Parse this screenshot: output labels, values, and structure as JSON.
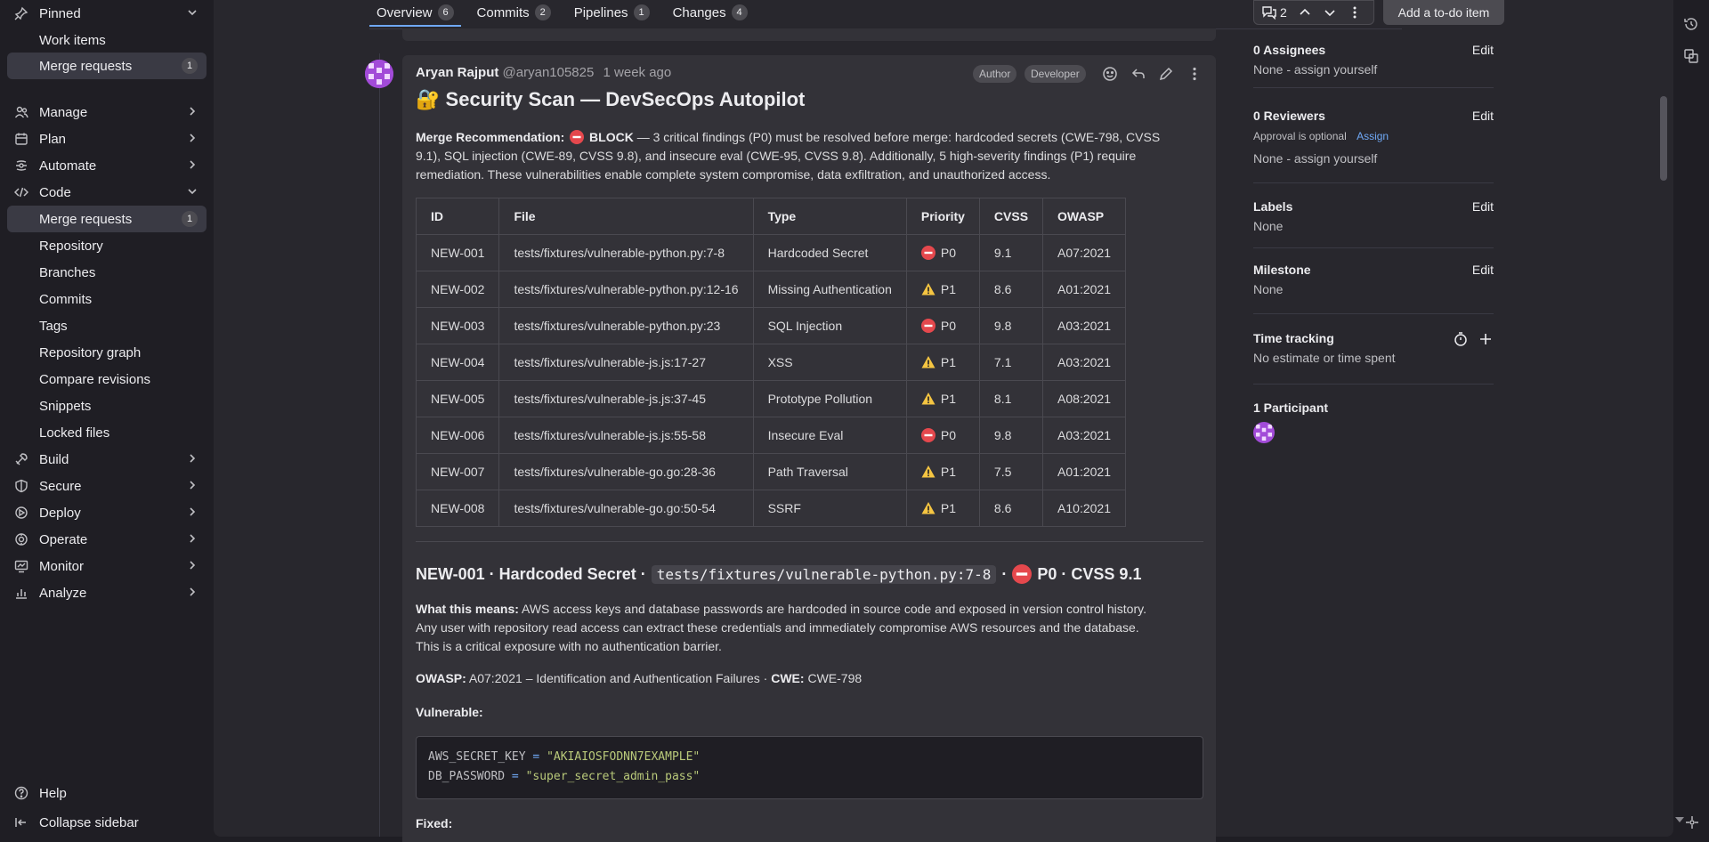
{
  "sidebar": {
    "items": [
      {
        "label": "Pinned",
        "icon": "pin-icon",
        "chevron": "down"
      },
      {
        "label": "Work items",
        "sub": true
      },
      {
        "label": "Merge requests",
        "sub": true,
        "count": "1",
        "active": true
      },
      {
        "label": "Manage",
        "icon": "users-icon",
        "chevron": "right"
      },
      {
        "label": "Plan",
        "icon": "calendar-icon",
        "chevron": "right"
      },
      {
        "label": "Automate",
        "icon": "rocket-icon",
        "chevron": "right"
      },
      {
        "label": "Code",
        "icon": "code-icon",
        "chevron": "down"
      },
      {
        "label": "Merge requests",
        "sub": true,
        "count": "1",
        "active": true
      },
      {
        "label": "Repository",
        "sub": true
      },
      {
        "label": "Branches",
        "sub": true
      },
      {
        "label": "Commits",
        "sub": true
      },
      {
        "label": "Tags",
        "sub": true
      },
      {
        "label": "Repository graph",
        "sub": true
      },
      {
        "label": "Compare revisions",
        "sub": true
      },
      {
        "label": "Snippets",
        "sub": true
      },
      {
        "label": "Locked files",
        "sub": true
      },
      {
        "label": "Build",
        "icon": "build-icon",
        "chevron": "right"
      },
      {
        "label": "Secure",
        "icon": "shield-icon",
        "chevron": "right"
      },
      {
        "label": "Deploy",
        "icon": "deploy-icon",
        "chevron": "right"
      },
      {
        "label": "Operate",
        "icon": "operate-icon",
        "chevron": "right"
      },
      {
        "label": "Monitor",
        "icon": "monitor-icon",
        "chevron": "right"
      },
      {
        "label": "Analyze",
        "icon": "chart-icon",
        "chevron": "right"
      }
    ],
    "help": "Help",
    "collapse": "Collapse sidebar"
  },
  "tabs": [
    {
      "label": "Overview",
      "count": "6",
      "active": true
    },
    {
      "label": "Commits",
      "count": "2"
    },
    {
      "label": "Pipelines",
      "count": "1"
    },
    {
      "label": "Changes",
      "count": "4"
    }
  ],
  "thread_controls": {
    "count": "2"
  },
  "todo_button": "Add a to-do item",
  "note": {
    "author_name": "Aryan Rajput",
    "author_handle": "@aryan105825",
    "time": "1 week ago",
    "badges": [
      "Author",
      "Developer"
    ],
    "title_emoji": "🔐",
    "title": "Security Scan — DevSecOps Autopilot",
    "rec_label": "Merge Recommendation:",
    "rec_status": "BLOCK",
    "rec_text_1": " — 3 critical findings (P0) must be resolved before merge: hardcoded secrets (CWE-798, CVSS",
    "rec_text_2": "9.1), SQL injection (CWE-89, CVSS 9.8), and insecure eval (CWE-95, CVSS 9.8). Additionally, 5 high-severity findings (P1) require",
    "rec_text_3": "remediation. These vulnerabilities enable complete system compromise, data exfiltration, and unauthorized access."
  },
  "table": {
    "headers": [
      "ID",
      "File",
      "Type",
      "Priority",
      "CVSS",
      "OWASP"
    ],
    "rows": [
      {
        "id": "NEW-001",
        "file": "tests/fixtures/vulnerable-python.py:7-8",
        "type": "Hardcoded Secret",
        "sev": "block",
        "priority": "P0",
        "cvss": "9.1",
        "owasp": "A07:2021"
      },
      {
        "id": "NEW-002",
        "file": "tests/fixtures/vulnerable-python.py:12-16",
        "type": "Missing Authentication",
        "sev": "warn",
        "priority": "P1",
        "cvss": "8.6",
        "owasp": "A01:2021"
      },
      {
        "id": "NEW-003",
        "file": "tests/fixtures/vulnerable-python.py:23",
        "type": "SQL Injection",
        "sev": "block",
        "priority": "P0",
        "cvss": "9.8",
        "owasp": "A03:2021"
      },
      {
        "id": "NEW-004",
        "file": "tests/fixtures/vulnerable-js.js:17-27",
        "type": "XSS",
        "sev": "warn",
        "priority": "P1",
        "cvss": "7.1",
        "owasp": "A03:2021"
      },
      {
        "id": "NEW-005",
        "file": "tests/fixtures/vulnerable-js.js:37-45",
        "type": "Prototype Pollution",
        "sev": "warn",
        "priority": "P1",
        "cvss": "8.1",
        "owasp": "A08:2021"
      },
      {
        "id": "NEW-006",
        "file": "tests/fixtures/vulnerable-js.js:55-58",
        "type": "Insecure Eval",
        "sev": "block",
        "priority": "P0",
        "cvss": "9.8",
        "owasp": "A03:2021"
      },
      {
        "id": "NEW-007",
        "file": "tests/fixtures/vulnerable-go.go:28-36",
        "type": "Path Traversal",
        "sev": "warn",
        "priority": "P1",
        "cvss": "7.5",
        "owasp": "A01:2021"
      },
      {
        "id": "NEW-008",
        "file": "tests/fixtures/vulnerable-go.go:50-54",
        "type": "SSRF",
        "sev": "warn",
        "priority": "P1",
        "cvss": "8.6",
        "owasp": "A10:2021"
      }
    ]
  },
  "finding": {
    "heading_pre": "NEW-001 · Hardcoded Secret ·",
    "heading_code": "tests/fixtures/vulnerable-python.py:7-8",
    "heading_post": "P0 · CVSS 9.1",
    "meaning_label": "What this means:",
    "meaning_1": " AWS access keys and database passwords are hardcoded in source code and exposed in version control history.",
    "meaning_2": "Any user with repository read access can extract these credentials and immediately compromise AWS resources and the database.",
    "meaning_3": "This is a critical exposure with no authentication barrier.",
    "owasp_label": "OWASP:",
    "owasp_value": " A07:2021 – Identification and Authentication Failures · ",
    "cwe_label": "CWE:",
    "cwe_value": " CWE-798",
    "vulnerable_label": "Vulnerable:",
    "code_line1_key": "AWS_SECRET_KEY",
    "code_line1_val": "\"AKIAIOSFODNN7EXAMPLE\"",
    "code_line2_key": "DB_PASSWORD",
    "code_line2_val": "\"super_secret_admin_pass\"",
    "code_op": "=",
    "fixed_label": "Fixed:"
  },
  "right_sidebar": {
    "assignees_h": "0 Assignees",
    "assignees_edit": "Edit",
    "assignees_v": "None - assign yourself",
    "reviewers_h": "0 Reviewers",
    "reviewers_edit": "Edit",
    "approval": "Approval is optional",
    "assign": "Assign",
    "reviewers_v": "None - assign yourself",
    "labels_h": "Labels",
    "labels_edit": "Edit",
    "labels_v": "None",
    "milestone_h": "Milestone",
    "milestone_edit": "Edit",
    "milestone_v": "None",
    "time_h": "Time tracking",
    "time_v": "No estimate or time spent",
    "participants_h": "1 Participant"
  }
}
